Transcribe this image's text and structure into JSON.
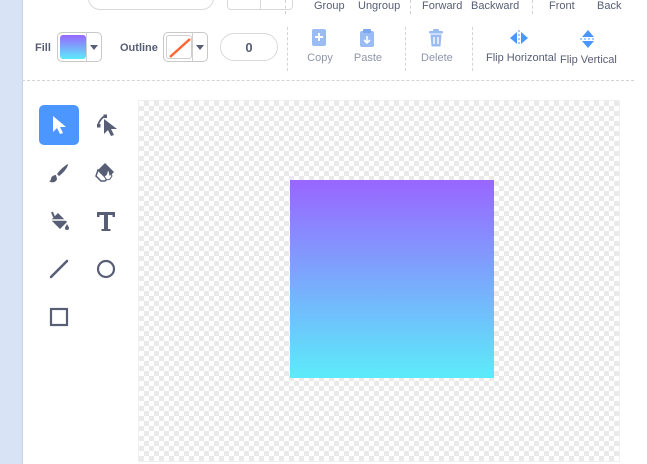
{
  "toolbar_top": {
    "group_label": "Group",
    "ungroup_label": "Ungroup",
    "forward_label": "Forward",
    "backward_label": "Backward",
    "front_label": "Front",
    "back_label": "Back"
  },
  "style": {
    "fill_label": "Fill",
    "outline_label": "Outline",
    "outline_width": "0",
    "fill_gradient_top": "#9966ff",
    "fill_gradient_bottom": "#5cebfa"
  },
  "actions": {
    "copy_label": "Copy",
    "paste_label": "Paste",
    "delete_label": "Delete",
    "flip_h_label": "Flip Horizontal",
    "flip_v_label": "Flip Vertical"
  },
  "tools": [
    {
      "name": "select-tool",
      "icon": "arrow-pointer-icon",
      "active": true
    },
    {
      "name": "reshape-tool",
      "icon": "reshape-icon",
      "active": false
    },
    {
      "name": "brush-tool",
      "icon": "brush-icon",
      "active": false
    },
    {
      "name": "eraser-tool",
      "icon": "eraser-icon",
      "active": false
    },
    {
      "name": "fill-tool",
      "icon": "paint-bucket-icon",
      "active": false
    },
    {
      "name": "text-tool",
      "icon": "text-t-icon",
      "active": false
    },
    {
      "name": "line-tool",
      "icon": "line-icon",
      "active": false
    },
    {
      "name": "circle-tool",
      "icon": "circle-icon",
      "active": false
    },
    {
      "name": "rectangle-tool",
      "icon": "rectangle-icon",
      "active": false
    }
  ],
  "colors": {
    "accent": "#4c97ff",
    "text": "#575e75",
    "muted": "#8f96ac"
  }
}
